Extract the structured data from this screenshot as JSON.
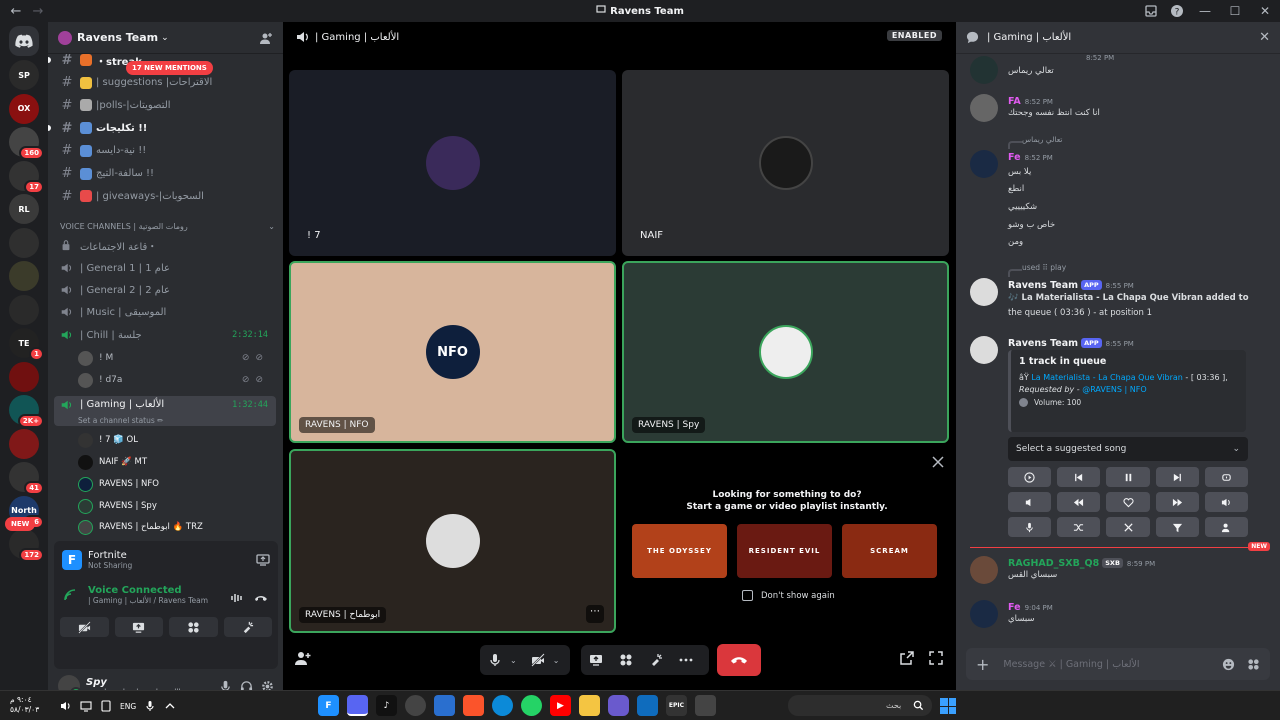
{
  "window": {
    "title": "Ravens Team"
  },
  "rail": {
    "servers": [
      {
        "label": "SP",
        "color": "#2a2a2a",
        "badge": ""
      },
      {
        "label": "OX",
        "color": "#8a1010",
        "badge": ""
      },
      {
        "label": "",
        "color": "#444",
        "badge": "160"
      },
      {
        "label": "",
        "color": "#333",
        "badge": "17"
      },
      {
        "label": "RL",
        "color": "#3a3a3a",
        "badge": ""
      },
      {
        "label": "",
        "color": "#2f2f2f",
        "badge": ""
      },
      {
        "label": "",
        "color": "#3b3b2a",
        "badge": ""
      },
      {
        "label": "",
        "color": "#2a2a2a",
        "badge": ""
      },
      {
        "label": "TE",
        "color": "#222",
        "badge": "1"
      },
      {
        "label": "",
        "color": "#701010",
        "badge": ""
      },
      {
        "label": "",
        "color": "#155",
        "badge": "2K+"
      },
      {
        "label": "",
        "color": "#801818",
        "badge": ""
      },
      {
        "label": "",
        "color": "#333",
        "badge": "41"
      },
      {
        "label": "North",
        "color": "#1e3a6a",
        "badge": "96"
      },
      {
        "label": "",
        "color": "#2a2a2a",
        "badge": "172"
      }
    ],
    "new_label": "NEW"
  },
  "sidebar": {
    "server_name": "Ravens Team",
    "mentions": "17 NEW MENTIONS",
    "text_channels": [
      {
        "name": "・streak",
        "unread": true,
        "emoji": "#e8702a"
      },
      {
        "name": "| suggestions |الاقتراحات",
        "unread": false,
        "emoji": "#f0c040"
      },
      {
        "name": "|polls-|التصويتات",
        "unread": false,
        "emoji": "#aaa"
      },
      {
        "name": "تكليجات !!",
        "unread": true,
        "emoji": "#5b8fd6"
      },
      {
        "name": "نية-دايسه !!",
        "unread": false,
        "emoji": "#5b8fd6"
      },
      {
        "name": "سالفة-التيج !!",
        "unread": false,
        "emoji": "#5b8fd6"
      },
      {
        "name": "| giveaways-|السحوبات",
        "unread": false,
        "emoji": "#e84a4a"
      }
    ],
    "voice_category": "VOICE CHANNELS | رومات الصوتية",
    "voice_channels": [
      {
        "name": "قاعة الاجتماعات・",
        "icon": "lock",
        "time": ""
      },
      {
        "name": "| General 1 | عام 1",
        "icon": "speaker",
        "time": ""
      },
      {
        "name": "| General 2 | عام 2",
        "icon": "speaker",
        "time": ""
      },
      {
        "name": "| Music | الموسيقى",
        "icon": "speaker",
        "time": ""
      },
      {
        "name": "| Chill | جلسة",
        "icon": "speaker",
        "time": "2:32:14"
      }
    ],
    "chill_users": [
      "! M",
      "! d7a"
    ],
    "gaming_channel": {
      "name": "| Gaming | الألعاب",
      "time": "1:32:44",
      "status": "Set a channel status ✏"
    },
    "gaming_users": [
      "! 7 🧊 OL",
      "NAIF 🚀 MT",
      "RAVENS | NFO",
      "RAVENS | Spy",
      "RAVENS | ابوطماح 🔥 TRZ"
    ]
  },
  "activity": {
    "game": "Fortnite",
    "status": "Not Sharing",
    "game_icon_letter": "F"
  },
  "voice": {
    "status": "Voice Connected",
    "location": "| Gaming | الألعاب / Ravens Team"
  },
  "user": {
    "name": "Spy",
    "status": "اللهم صلي وسلم على نبينا محمد"
  },
  "stage": {
    "channel": "| Gaming | الألعاب",
    "enabled": "ENABLED",
    "tiles": [
      {
        "label": "! 7",
        "bg": "#1a1d26",
        "av": "#3a2a5a"
      },
      {
        "label": "NAIF",
        "bg": "#2a2b2e",
        "av": "#222"
      },
      {
        "label": "RAVENS | NFO",
        "bg": "#d7b59c",
        "av": "#0e1f3c"
      },
      {
        "label": "RAVENS | Spy",
        "bg": "#2b3b35",
        "av": "#eee"
      },
      {
        "label": "RAVENS | ابوطماح",
        "bg": "#2a241f",
        "av": "#ddd"
      }
    ],
    "activity_card": {
      "line1": "Looking for something to do?",
      "line2": "Start a game or video playlist instantly.",
      "games": [
        {
          "name": "THE ODYSSEY",
          "color": "#b2411a"
        },
        {
          "name": "RESIDENT EVIL",
          "color": "#6a1a12"
        },
        {
          "name": "SCREAM",
          "color": "#8a2a12"
        }
      ],
      "dont_show": "Don't show again"
    }
  },
  "chat": {
    "header": "| Gaming | الألعاب",
    "messages": [
      {
        "name": "",
        "time": "8:52 PM",
        "lines": [
          "تعالي ريماس"
        ],
        "color": "#f2f3f5"
      },
      {
        "name": "FA",
        "time": "8:52 PM",
        "lines": [
          "انا كنت انتظ نفسه وجحتك"
        ],
        "color": "#e15bf0"
      },
      {
        "name": "Fe",
        "time": "8:52 PM",
        "reply": "تعالي ريماس",
        "lines": [
          "يلا بس",
          "انطع",
          "شكييييي",
          "خاص ب وشو",
          "ومن"
        ],
        "color": "#e15bf0"
      },
      {
        "name": "Ravens Team",
        "time": "8:55 PM",
        "reply": "used ⠿ play",
        "tag": "APP",
        "lines": [
          "🎶 La Materialista - La Chapa Que Vibran added to",
          "the queue ( 03:36 ) - at position 1"
        ],
        "color": "#f2f3f5"
      },
      {
        "name": "Ravens Team",
        "time": "8:55 PM",
        "tag": "APP",
        "color": "#f2f3f5"
      }
    ],
    "embed": {
      "title": "1 track in queue",
      "track": "La Materialista - La Chapa Que Vibran",
      "prefix": "âŸ",
      "duration": "[ 03:36 ],",
      "req_label": "Requested by -",
      "req_user": "@RAVENS | NFO",
      "volume": "Volume: 100"
    },
    "select": "Select a suggested song",
    "new": "NEW",
    "late_messages": [
      {
        "name": "RAGHAD_SXB_Q8",
        "tag": "SXB",
        "time": "8:59 PM",
        "line": "سبساي القس",
        "color": "#23a55a"
      },
      {
        "name": "Fe",
        "time": "9:04 PM",
        "line": "سبساي",
        "color": "#e15bf0"
      }
    ],
    "composer_placeholder": "Message ⚔ | Gaming | الألعاب"
  },
  "taskbar": {
    "time": "٩:٠٤ م",
    "date": "٥٨/٠٣/٠٣",
    "lang": "ENG",
    "search": "بحث"
  }
}
